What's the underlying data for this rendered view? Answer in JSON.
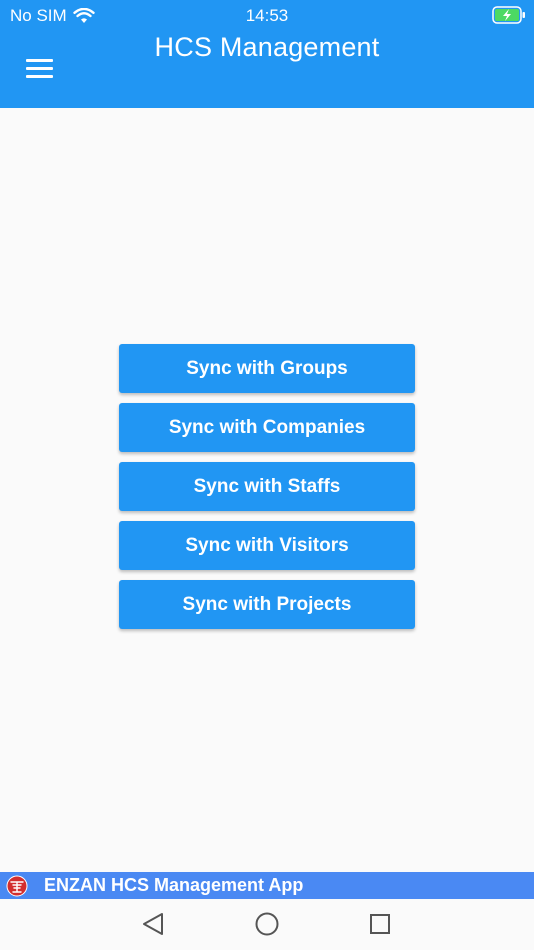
{
  "status_bar": {
    "carrier": "No SIM",
    "time": "14:53"
  },
  "header": {
    "title": "HCS Management"
  },
  "actions": [
    {
      "label": "Sync with Groups"
    },
    {
      "label": "Sync with Companies"
    },
    {
      "label": "Sync with Staffs"
    },
    {
      "label": "Sync with Visitors"
    },
    {
      "label": "Sync with Projects"
    }
  ],
  "footer": {
    "banner_text": "ENZAN HCS Management App"
  },
  "icons": {
    "menu": "hamburger-menu-icon",
    "wifi": "wifi-icon",
    "battery": "battery-charging-icon",
    "logo": "enzan-logo-icon",
    "back": "back-triangle-icon",
    "home": "home-circle-icon",
    "recent": "recent-square-icon"
  },
  "colors": {
    "primary": "#2196f3",
    "footer": "#4a89f3",
    "background": "#fafafa",
    "battery_fill": "#4cd964",
    "logo_red": "#d32f2f"
  }
}
